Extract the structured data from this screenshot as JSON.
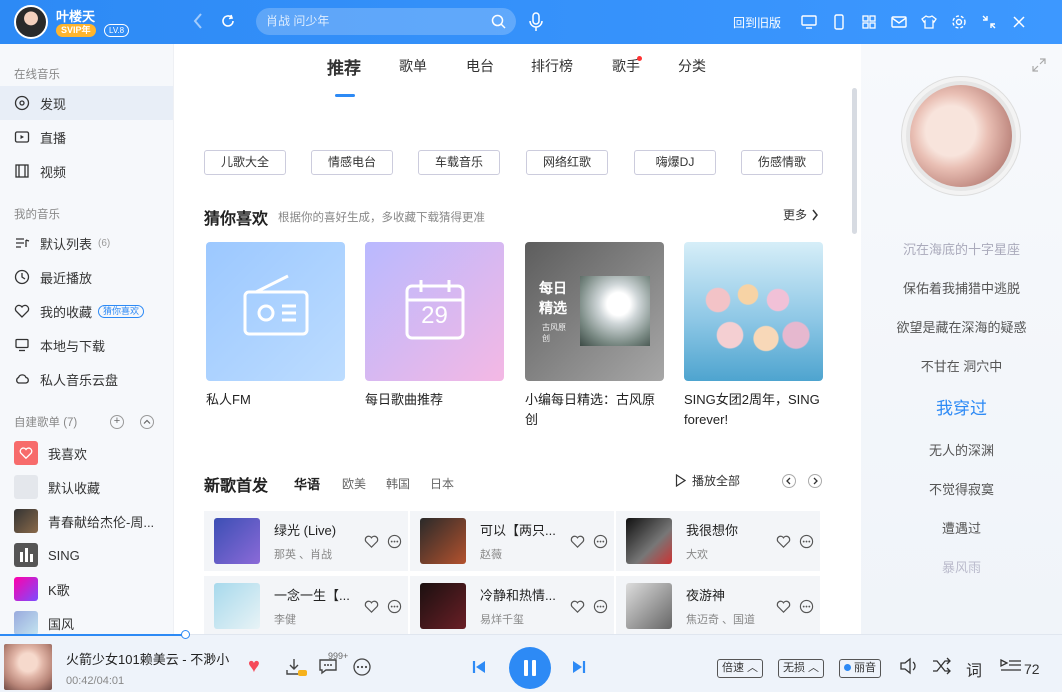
{
  "header": {
    "username": "叶楼天",
    "vip_badge": "SVIP年",
    "level_badge": "LV.8",
    "search_placeholder": "肖战 问少年",
    "back_to_old": "回到旧版"
  },
  "sidebar": {
    "online_title": "在线音乐",
    "online_items": [
      {
        "label": "发现",
        "icon": "disc-icon"
      },
      {
        "label": "直播",
        "icon": "tv-icon"
      },
      {
        "label": "视频",
        "icon": "film-icon"
      }
    ],
    "my_title": "我的音乐",
    "my_items": [
      {
        "label": "默认列表",
        "count": "(6)",
        "icon": "list-icon"
      },
      {
        "label": "最近播放",
        "icon": "clock-icon"
      },
      {
        "label": "我的收藏",
        "badge": "猜你喜欢",
        "icon": "heart-icon"
      },
      {
        "label": "本地与下载",
        "icon": "monitor-icon"
      },
      {
        "label": "私人音乐云盘",
        "icon": "cloud-icon"
      }
    ],
    "playlists_title": "自建歌单",
    "playlists_count": "(7)",
    "playlists": [
      "我喜欢",
      "默认收藏",
      "青春献给杰伦-周...",
      "SING",
      "K歌",
      "国风"
    ]
  },
  "main": {
    "tabs": [
      "推荐",
      "歌单",
      "电台",
      "排行榜",
      "歌手",
      "分类"
    ],
    "active_tab": 0,
    "chips": [
      "儿歌大全",
      "情感电台",
      "车载音乐",
      "网络红歌",
      "嗨爆DJ",
      "伤感情歌"
    ],
    "guess": {
      "title": "猜你喜欢",
      "subtitle": "根据你的喜好生成，多收藏下载猜得更准",
      "more": "更多",
      "cards": [
        {
          "title": "私人FM"
        },
        {
          "title": "每日歌曲推荐",
          "day": "29"
        },
        {
          "title": "小编每日精选：古风原创",
          "cover_title": "每日精选",
          "cover_sub": "古风原创"
        },
        {
          "title": "SING女团2周年，SING forever!"
        }
      ]
    },
    "newsongs": {
      "title": "新歌首发",
      "langs": [
        "华语",
        "欧美",
        "韩国",
        "日本"
      ],
      "play_all": "播放全部",
      "songs": [
        {
          "name": "绿光 (Live)",
          "artist": "那英 、肖战"
        },
        {
          "name": "可以【两只...",
          "artist": "赵薇"
        },
        {
          "name": "我很想你",
          "artist": "大欢"
        },
        {
          "name": "一念一生【...",
          "artist": "李健"
        },
        {
          "name": "冷静和热情...",
          "artist": "易烊千玺"
        },
        {
          "name": "夜游神",
          "artist": "焦迈奇 、国道"
        }
      ]
    }
  },
  "lyrics": [
    "沉在海底的十字星座",
    "保佑着我捕猎中逃脱",
    "欲望是藏在深海的疑惑",
    "不甘在 洞穴中",
    "我穿过",
    "无人的深渊",
    "不觉得寂寞",
    "遭遇过",
    "暴风雨"
  ],
  "player": {
    "title": "火箭少女101赖美云 - 不渺小",
    "time": "00:42/04:01",
    "progress": 0.174,
    "comment_count": "999+",
    "speed": "倍速",
    "quality": "无损",
    "effect": "丽音",
    "lyric_btn": "词",
    "volume": "72"
  },
  "colors": {
    "accent": "#2d8af5",
    "like": "#f54a5a"
  }
}
